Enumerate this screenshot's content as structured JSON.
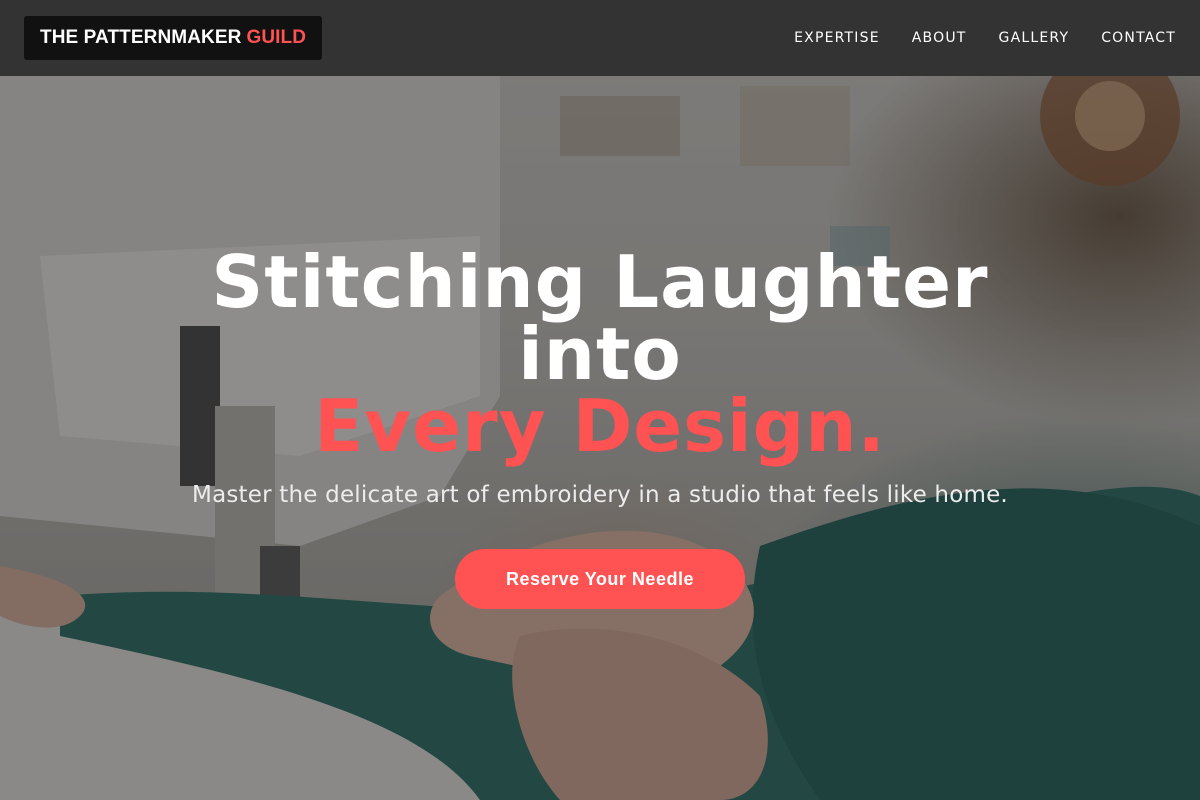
{
  "header": {
    "logo_main": "THE PATTERNMAKER",
    "logo_accent": "GUILD",
    "nav": [
      {
        "label": "EXPERTISE"
      },
      {
        "label": "ABOUT"
      },
      {
        "label": "GALLERY"
      },
      {
        "label": "CONTACT"
      }
    ]
  },
  "hero": {
    "title_line1": "Stitching Laughter",
    "title_line2": "into",
    "title_accent": "Every Design.",
    "subtitle": "Master the delicate art of embroidery in a studio that feels like home.",
    "cta_label": "Reserve Your Needle"
  },
  "colors": {
    "accent": "#ff5252",
    "header_bg": "#333333",
    "logo_bg": "#111111"
  }
}
